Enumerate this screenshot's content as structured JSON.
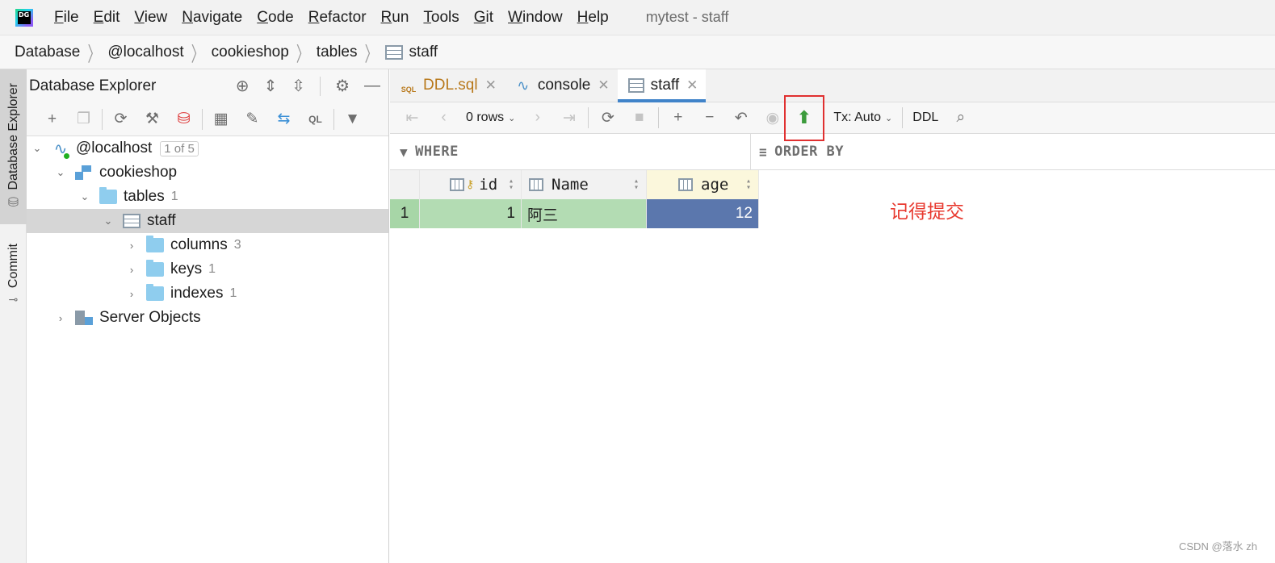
{
  "menubar": {
    "logo_text": "DG",
    "items": [
      {
        "label": "File",
        "mnemonic": "F",
        "rest": "ile"
      },
      {
        "label": "Edit",
        "mnemonic": "E",
        "rest": "dit"
      },
      {
        "label": "View",
        "mnemonic": "V",
        "rest": "iew"
      },
      {
        "label": "Navigate",
        "mnemonic": "N",
        "rest": "avigate"
      },
      {
        "label": "Code",
        "mnemonic": "C",
        "rest": "ode"
      },
      {
        "label": "Refactor",
        "mnemonic": "R",
        "rest": "efactor"
      },
      {
        "label": "Run",
        "mnemonic": "R",
        "rest": "un"
      },
      {
        "label": "Tools",
        "mnemonic": "T",
        "rest": "ools"
      },
      {
        "label": "Git",
        "mnemonic": "G",
        "rest": "it"
      },
      {
        "label": "Window",
        "mnemonic": "W",
        "rest": "indow"
      },
      {
        "label": "Help",
        "mnemonic": "H",
        "rest": "elp"
      }
    ],
    "window_title": "mytest - staff"
  },
  "breadcrumb": {
    "items": [
      "Database",
      "@localhost",
      "cookieshop",
      "tables",
      "staff"
    ]
  },
  "left_stripe": {
    "database_explorer": "Database Explorer",
    "commit": "Commit"
  },
  "explorer": {
    "title": "Database Explorer",
    "tree": {
      "host": {
        "label": "@localhost",
        "badge": "1 of 5"
      },
      "schema": {
        "label": "cookieshop"
      },
      "tables": {
        "label": "tables",
        "count": "1"
      },
      "staff": {
        "label": "staff"
      },
      "columns": {
        "label": "columns",
        "count": "3"
      },
      "keys": {
        "label": "keys",
        "count": "1"
      },
      "indexes": {
        "label": "indexes",
        "count": "1"
      },
      "server_objects": {
        "label": "Server Objects"
      }
    }
  },
  "editor": {
    "tabs": [
      {
        "label": "DDL.sql",
        "icon": "sql-file-icon"
      },
      {
        "label": "console",
        "icon": "console-icon"
      },
      {
        "label": "staff",
        "icon": "table-icon",
        "active": true
      }
    ],
    "toolbar": {
      "rows": "0 rows",
      "tx": "Tx: Auto",
      "ddl": "DDL"
    },
    "filter": {
      "where": "WHERE",
      "order_by": "ORDER BY"
    },
    "grid": {
      "columns": [
        "id",
        "Name",
        "age"
      ],
      "rows": [
        {
          "rownum": "1",
          "id": "1",
          "name": "阿三",
          "age": "12"
        }
      ]
    }
  },
  "annotation": "记得提交",
  "watermark": "CSDN @落水 zh",
  "colors": {
    "highlight_box": "#e03030",
    "annotation": "#e8392f",
    "row_modified": "#b3dcb3",
    "cell_selected": "#5b77ad",
    "tab_underline": "#4083c9"
  }
}
